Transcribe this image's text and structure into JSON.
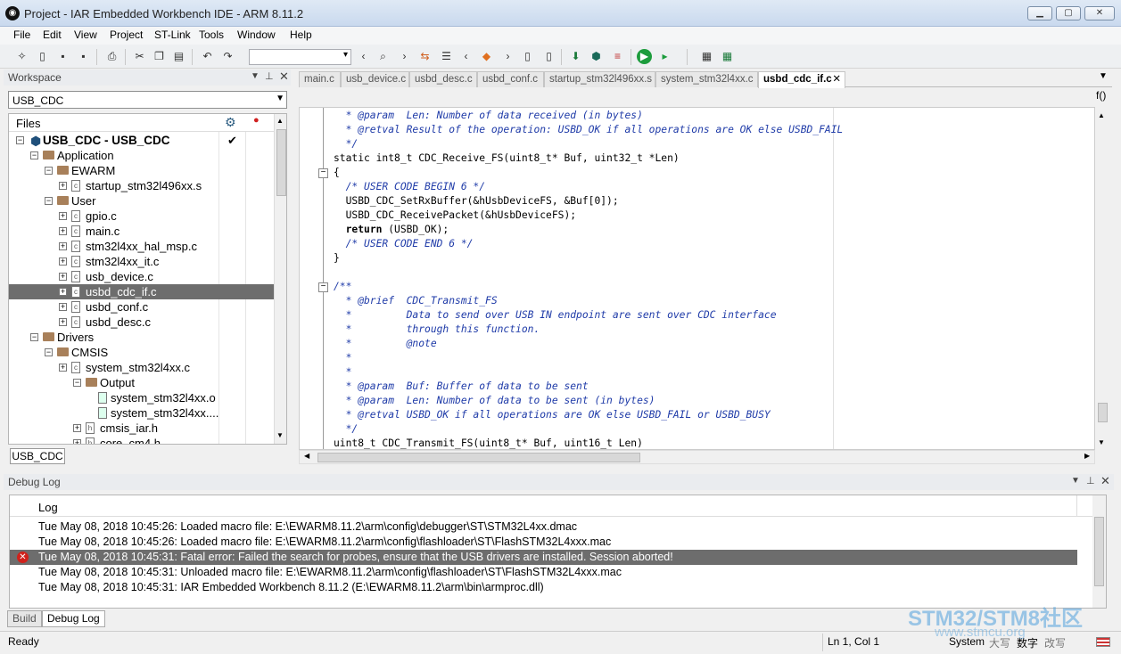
{
  "window": {
    "title": "Project - IAR Embedded Workbench IDE - ARM 8.11.2"
  },
  "menu": [
    "File",
    "Edit",
    "View",
    "Project",
    "ST-Link",
    "Tools",
    "Window",
    "Help"
  ],
  "workspace": {
    "header": "Workspace",
    "combo": "USB_CDC",
    "files_label": "Files",
    "tab": "USB_CDC",
    "tree": [
      {
        "label": "USB_CDC - USB_CDC",
        "level": 0,
        "type": "project",
        "check": "✔"
      },
      {
        "label": "Application",
        "level": 1,
        "type": "folder"
      },
      {
        "label": "EWARM",
        "level": 2,
        "type": "folder"
      },
      {
        "label": "startup_stm32l496xx.s",
        "level": 3,
        "type": "file"
      },
      {
        "label": "User",
        "level": 2,
        "type": "folder"
      },
      {
        "label": "gpio.c",
        "level": 3,
        "type": "file"
      },
      {
        "label": "main.c",
        "level": 3,
        "type": "file"
      },
      {
        "label": "stm32l4xx_hal_msp.c",
        "level": 3,
        "type": "file"
      },
      {
        "label": "stm32l4xx_it.c",
        "level": 3,
        "type": "file"
      },
      {
        "label": "usb_device.c",
        "level": 3,
        "type": "file"
      },
      {
        "label": "usbd_cdc_if.c",
        "level": 3,
        "type": "file",
        "selected": true
      },
      {
        "label": "usbd_conf.c",
        "level": 3,
        "type": "file"
      },
      {
        "label": "usbd_desc.c",
        "level": 3,
        "type": "file"
      },
      {
        "label": "Drivers",
        "level": 1,
        "type": "folder"
      },
      {
        "label": "CMSIS",
        "level": 2,
        "type": "folder"
      },
      {
        "label": "system_stm32l4xx.c",
        "level": 3,
        "type": "file"
      },
      {
        "label": "Output",
        "level": 4,
        "type": "folder"
      },
      {
        "label": "system_stm32l4xx.o",
        "level": 5,
        "type": "obj"
      },
      {
        "label": "system_stm32l4xx....",
        "level": 5,
        "type": "obj"
      },
      {
        "label": "cmsis_iar.h",
        "level": 4,
        "type": "header"
      },
      {
        "label": "core_cm4.h",
        "level": 4,
        "type": "header"
      }
    ]
  },
  "editor": {
    "tabs": [
      "main.c",
      "usb_device.c",
      "usbd_desc.c",
      "usbd_conf.c",
      "startup_stm32l496xx.s",
      "system_stm32l4xx.c",
      "usbd_cdc_if.c"
    ],
    "active_tab": "usbd_cdc_if.c",
    "func_icon": "f()",
    "lines": [
      {
        "t": "  * @param  Len: Number of data received (in bytes)",
        "c": "cm"
      },
      {
        "t": "  * @retval Result of the operation: USBD_OK if all operations are OK else USBD_FAIL",
        "c": "cm"
      },
      {
        "t": "  */",
        "c": "cm"
      },
      {
        "t": "static int8_t CDC_Receive_FS(uint8_t* Buf, uint32_t *Len)",
        "c": ""
      },
      {
        "t": "{",
        "c": ""
      },
      {
        "t": "  /* USER CODE BEGIN 6 */",
        "c": "cm"
      },
      {
        "t": "  USBD_CDC_SetRxBuffer(&hUsbDeviceFS, &Buf[0]);",
        "c": ""
      },
      {
        "t": "  USBD_CDC_ReceivePacket(&hUsbDeviceFS);",
        "c": ""
      },
      {
        "t": "  return (USBD_OK);",
        "c": "ret"
      },
      {
        "t": "  /* USER CODE END 6 */",
        "c": "cm"
      },
      {
        "t": "}",
        "c": ""
      },
      {
        "t": "",
        "c": ""
      },
      {
        "t": "/**",
        "c": "cm"
      },
      {
        "t": "  * @brief  CDC_Transmit_FS",
        "c": "cm"
      },
      {
        "t": "  *         Data to send over USB IN endpoint are sent over CDC interface",
        "c": "cm"
      },
      {
        "t": "  *         through this function.",
        "c": "cm"
      },
      {
        "t": "  *         @note",
        "c": "cm"
      },
      {
        "t": "  *",
        "c": "cm"
      },
      {
        "t": "  *",
        "c": "cm"
      },
      {
        "t": "  * @param  Buf: Buffer of data to be sent",
        "c": "cm"
      },
      {
        "t": "  * @param  Len: Number of data to be sent (in bytes)",
        "c": "cm"
      },
      {
        "t": "  * @retval USBD_OK if all operations are OK else USBD_FAIL or USBD_BUSY",
        "c": "cm"
      },
      {
        "t": "  */",
        "c": "cm"
      },
      {
        "t": "uint8_t CDC_Transmit_FS(uint8_t* Buf, uint16_t Len)",
        "c": ""
      }
    ]
  },
  "log": {
    "header": "Debug Log",
    "column": "Log",
    "rows": [
      {
        "text": "Tue May 08, 2018 10:45:26: Loaded macro file: E:\\EWARM8.11.2\\arm\\config\\debugger\\ST\\STM32L4xx.dmac",
        "error": false
      },
      {
        "text": "Tue May 08, 2018 10:45:26: Loaded macro file: E:\\EWARM8.11.2\\arm\\config\\flashloader\\ST\\FlashSTM32L4xxx.mac",
        "error": false
      },
      {
        "text": "Tue May 08, 2018 10:45:31: Fatal error: Failed the search for probes, ensure that the USB drivers are installed.   Session aborted!",
        "error": true
      },
      {
        "text": "Tue May 08, 2018 10:45:31: Unloaded macro file: E:\\EWARM8.11.2\\arm\\config\\flashloader\\ST\\FlashSTM32L4xxx.mac",
        "error": false
      },
      {
        "text": "Tue May 08, 2018 10:45:31: IAR Embedded Workbench 8.11.2 (E:\\EWARM8.11.2\\arm\\bin\\armproc.dll)",
        "error": false
      }
    ],
    "tabs": [
      "Build",
      "Debug Log"
    ],
    "active_tab": "Debug Log"
  },
  "status": {
    "left": "Ready",
    "pos": "Ln 1, Col 1",
    "system": "System",
    "caps": "大写",
    "num": "数字",
    "ovr": "改写"
  },
  "watermark": {
    "line1": "STM32/STM8社区",
    "line2": "www.stmcu.org"
  }
}
